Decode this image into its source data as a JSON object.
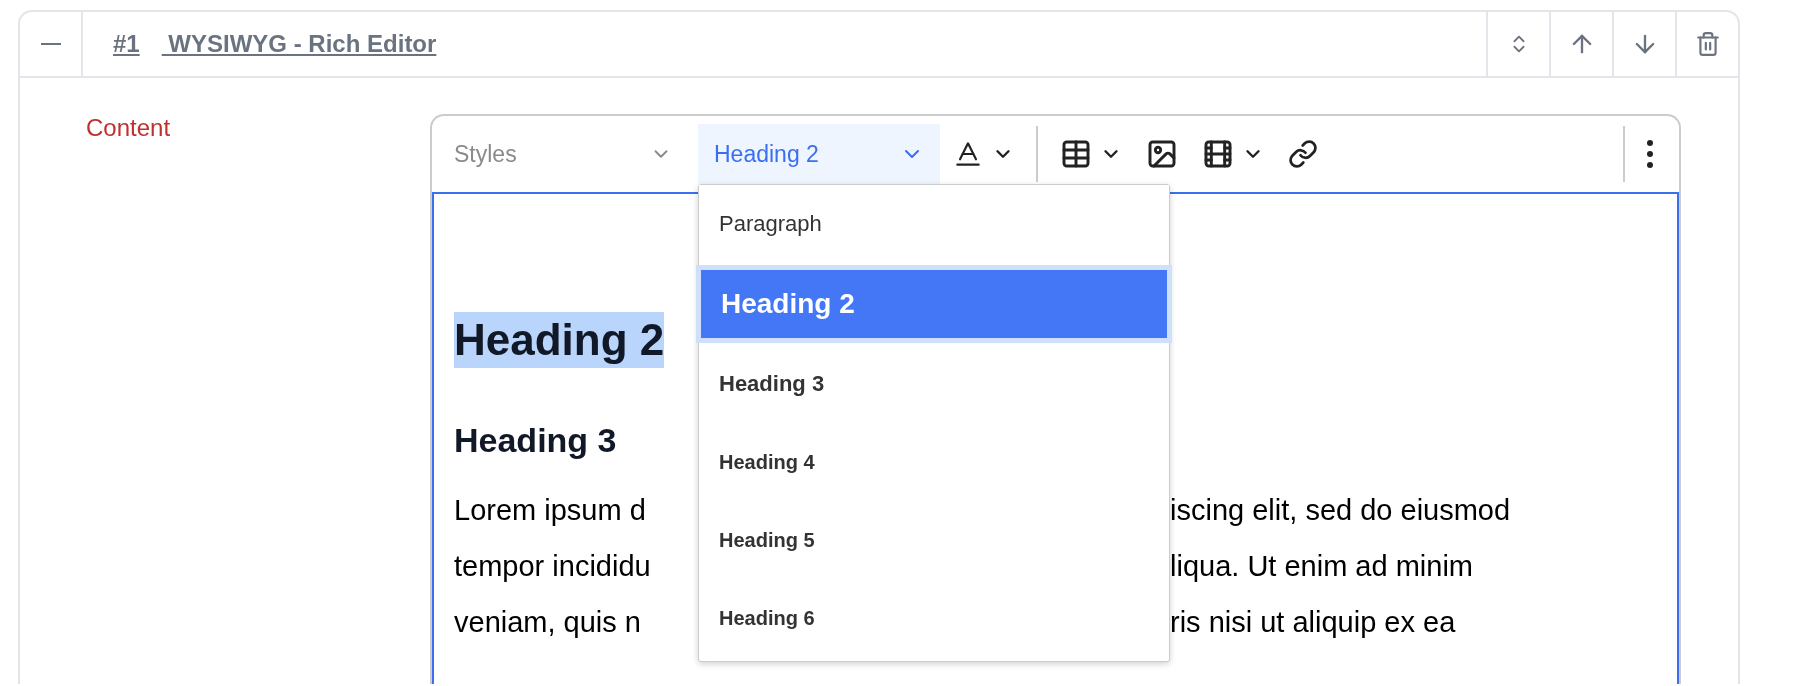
{
  "header": {
    "collapsed": false,
    "number": "#1",
    "title": " WYSIWYG - Rich Editor",
    "actions": [
      {
        "kind": "reorder"
      },
      {
        "kind": "up"
      },
      {
        "kind": "down"
      },
      {
        "kind": "delete"
      }
    ]
  },
  "field": {
    "label": "Content",
    "required": true
  },
  "toolbar": {
    "styles": {
      "label": "Styles"
    },
    "block_format": {
      "label": "Heading 2",
      "open": true
    },
    "tools": [
      {
        "kind": "font-color",
        "caret": true
      },
      {
        "kind": "table",
        "caret": true
      },
      {
        "kind": "image",
        "caret": false
      },
      {
        "kind": "video",
        "caret": true
      },
      {
        "kind": "link",
        "caret": false
      }
    ],
    "more": {
      "kind": "more"
    }
  },
  "menu": [
    {
      "label": "Paragraph",
      "kind": "paragraph",
      "selected": false
    },
    {
      "label": "Heading 2",
      "kind": "heading2",
      "selected": true
    },
    {
      "label": "Heading 3",
      "kind": "heading3",
      "selected": false
    },
    {
      "label": "Heading 4",
      "kind": "heading4",
      "selected": false
    },
    {
      "label": "Heading 5",
      "kind": "heading5",
      "selected": false
    },
    {
      "label": "Heading 6",
      "kind": "heading6",
      "selected": false
    }
  ],
  "content": [
    {
      "kind": "h2",
      "text": "Heading 2",
      "highlighted": true
    },
    {
      "kind": "h3",
      "text": "Heading 3",
      "highlighted": false
    },
    {
      "kind": "paragraph",
      "lines": [
        {
          "left": "Lorem ipsum d",
          "right": "iscing elit, sed do eiusmod"
        },
        {
          "left": "tempor incididu",
          "right": "liqua. Ut enim ad minim"
        },
        {
          "left": "veniam, quis n",
          "right": "ris nisi ut aliquip ex ea"
        }
      ]
    }
  ]
}
